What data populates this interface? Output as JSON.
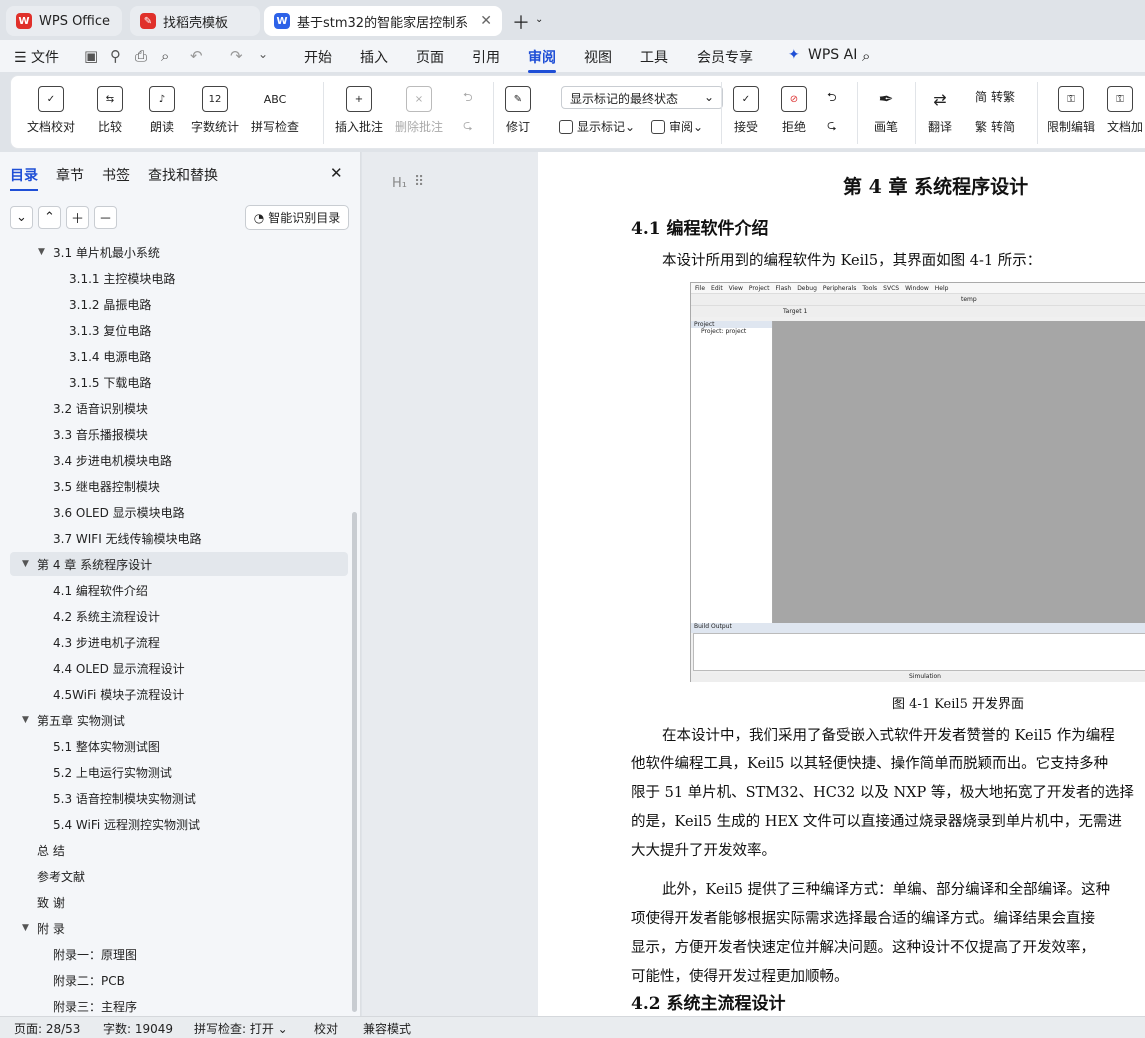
{
  "tabs": [
    {
      "label": "WPS Office",
      "icon_color": "#e0302a"
    },
    {
      "label": "找稻壳模板",
      "icon_color": "#e0302a"
    },
    {
      "label": "基于stm32的智能家居控制系",
      "icon_color": "#2d62e8"
    }
  ],
  "menu": {
    "file": "文件",
    "items": [
      "开始",
      "插入",
      "页面",
      "引用",
      "审阅",
      "视图",
      "工具",
      "会员专享"
    ],
    "active": "审阅",
    "ai": "WPS AI"
  },
  "ribbon": {
    "big": [
      "文档校对",
      "比较",
      "朗读",
      "字数统计",
      "拼写检查",
      "插入批注",
      "删除批注",
      "修订",
      "接受",
      "拒绝",
      "画笔",
      "翻译",
      "限制编辑",
      "文档加"
    ],
    "combo": "显示标记的最终状态",
    "show_marks": "显示标记",
    "review": "审阅",
    "trad": "转繁",
    "simp": "转简",
    "icon_text": {
      "wordcount": "12",
      "spell": "ABC"
    }
  },
  "panel": {
    "tabs": [
      "目录",
      "章节",
      "书签",
      "查找和替换"
    ],
    "active_tab": "目录",
    "smart": "智能识别目录",
    "toc": [
      {
        "label": "3.1 单片机最小系统",
        "level": 2,
        "tri": "▼"
      },
      {
        "label": "3.1.1  主控模块电路",
        "level": 3
      },
      {
        "label": "3.1.2  晶振电路",
        "level": 3
      },
      {
        "label": "3.1.3  复位电路",
        "level": 3
      },
      {
        "label": "3.1.4  电源电路",
        "level": 3
      },
      {
        "label": "3.1.5  下载电路",
        "level": 3
      },
      {
        "label": "3.2 语音识别模块",
        "level": 2
      },
      {
        "label": "3.3 音乐播报模块",
        "level": 2
      },
      {
        "label": "3.4 步进电机模块电路",
        "level": 2
      },
      {
        "label": "3.5 继电器控制模块",
        "level": 2
      },
      {
        "label": "3.6 OLED 显示模块电路",
        "level": 2
      },
      {
        "label": "3.7 WIFI 无线传输模块电路",
        "level": 2
      },
      {
        "label": "第 4 章  系统程序设计",
        "level": 1,
        "tri": "▼",
        "selected": true
      },
      {
        "label": "4.1  编程软件介绍",
        "level": 2
      },
      {
        "label": "4.2  系统主流程设计",
        "level": 2
      },
      {
        "label": "4.3 步进电机子流程",
        "level": 2
      },
      {
        "label": "4.4 OLED 显示流程设计",
        "level": 2
      },
      {
        "label": "4.5WiFi 模块子流程设计",
        "level": 2
      },
      {
        "label": "第五章  实物测试",
        "level": 1,
        "tri": "▼"
      },
      {
        "label": "5.1  整体实物测试图",
        "level": 2
      },
      {
        "label": "5.2  上电运行实物测试",
        "level": 2
      },
      {
        "label": "5.3  语音控制模块实物测试",
        "level": 2
      },
      {
        "label": "5.4 WiFi 远程测控实物测试",
        "level": 2
      },
      {
        "label": "总  结",
        "level": 1
      },
      {
        "label": "参考文献",
        "level": 1
      },
      {
        "label": "致  谢",
        "level": 1
      },
      {
        "label": "附  录",
        "level": 1,
        "tri": "▼"
      },
      {
        "label": "附录一：原理图",
        "level": 2
      },
      {
        "label": "附录二：PCB",
        "level": 2
      },
      {
        "label": "附录三：主程序",
        "level": 2
      }
    ]
  },
  "doc": {
    "heading_mark": "H₁",
    "chapter": "第 4 章  系统程序设计",
    "h41": "4.1  编程软件介绍",
    "p1": "本设计所用到的编程软件为 Keil5，其界面如图 4-1 所示：",
    "caption": "图 4-1 Keil5 开发界面",
    "p2": [
      "在本设计中，我们采用了备受嵌入式软件开发者赞誉的 Keil5 作为编程",
      "他软件编程工具，Keil5 以其轻便快捷、操作简单而脱颖而出。它支持多种",
      "限于 51 单片机、STM32、HC32 以及 NXP 等，极大地拓宽了开发者的选择",
      "的是，Keil5 生成的 HEX 文件可以直接通过烧录器烧录到单片机中，无需进",
      "大大提升了开发效率。"
    ],
    "p3": [
      "此外，Keil5 提供了三种编译方式：单编、部分编译和全部编译。这种",
      "项使得开发者能够根据实际需求选择最合适的编译方式。编译结果会直接",
      "显示，方便开发者快速定位并解决问题。这种设计不仅提高了开发效率，",
      "可能性，使得开发过程更加顺畅。"
    ],
    "h42": "4.2  系统主流程设计",
    "keil": {
      "menus": [
        "File",
        "Edit",
        "View",
        "Project",
        "Flash",
        "Debug",
        "Peripherals",
        "Tools",
        "SVCS",
        "Window",
        "Help"
      ],
      "target": "Target 1",
      "temp": "temp",
      "project": "Project",
      "tree": "Project: project",
      "build": "Build Output",
      "sim": "Simulation"
    }
  },
  "status": {
    "page": "页面: 28/53",
    "words": "字数: 19049",
    "spell": "拼写检查: 打开",
    "proof": "校对",
    "compat": "兼容模式"
  }
}
